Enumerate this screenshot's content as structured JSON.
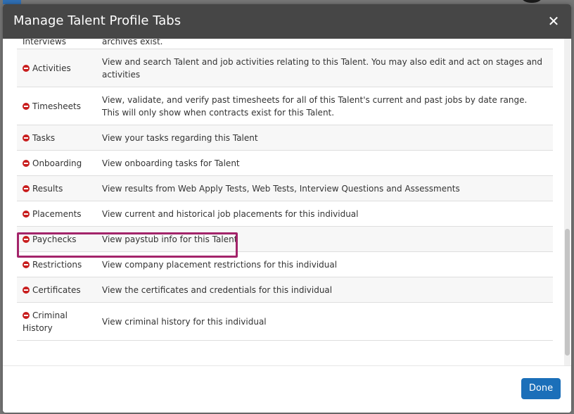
{
  "modal": {
    "title": "Manage Talent Profile Tabs",
    "close_glyph": "✕",
    "done_label": "Done"
  },
  "tabs": [
    {
      "name": "Interviews",
      "description": "archives exist."
    },
    {
      "name": "Activities",
      "description": "View and search Talent and job activities relating to this Talent. You may also edit and act on stages and activities"
    },
    {
      "name": "Timesheets",
      "description": "View, validate, and verify past timesheets for all of this Talent's current and past jobs by date range. This will only show when contracts exist for this Talent."
    },
    {
      "name": "Tasks",
      "description": "View your tasks regarding this Talent"
    },
    {
      "name": "Onboarding",
      "description": "View onboarding tasks for Talent"
    },
    {
      "name": "Results",
      "description": "View results from Web Apply Tests, Web Tests, Interview Questions and Assessments"
    },
    {
      "name": "Placements",
      "description": "View current and historical job placements for this individual"
    },
    {
      "name": "Paychecks",
      "description": "View paystub info for this Talent",
      "highlighted": true
    },
    {
      "name": "Restrictions",
      "description": "View company placement restrictions for this individual"
    },
    {
      "name": "Certificates",
      "description": "View the certificates and credentials for this individual"
    },
    {
      "name": "Criminal History",
      "description": "View criminal history for this individual"
    }
  ],
  "colors": {
    "header_bg": "#464646",
    "remove_icon": "#c81e1e",
    "highlight_border": "#a3246a",
    "done_button": "#1b6fb9"
  },
  "icons": {
    "remove": "remove-circle-icon",
    "close": "close-icon"
  }
}
